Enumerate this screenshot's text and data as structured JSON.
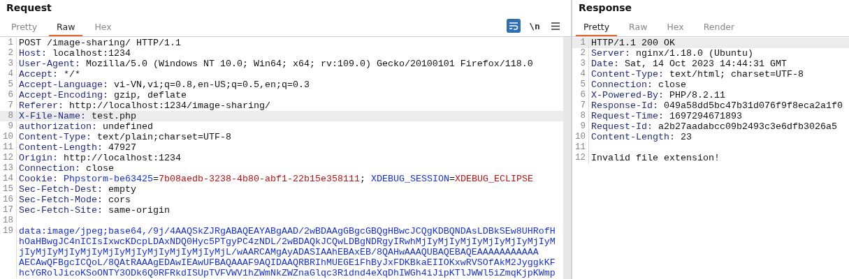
{
  "panes": [
    {
      "title": "Request",
      "tabs": [
        {
          "label": "Pretty",
          "selected": false
        },
        {
          "label": "Raw",
          "selected": true
        },
        {
          "label": "Hex",
          "selected": false
        }
      ],
      "tools": [
        {
          "kind": "wrap",
          "active": true
        },
        {
          "kind": "newline",
          "label": "\\n"
        },
        {
          "kind": "menu"
        }
      ],
      "lines": [
        {
          "number": "1",
          "highlighted": false,
          "segments": [
            {
              "kind": "text",
              "text": "POST /image-sharing/ HTTP/1.1"
            }
          ]
        },
        {
          "number": "2",
          "highlighted": false,
          "segments": [
            {
              "kind": "name",
              "text": "Host:"
            },
            {
              "kind": "text",
              "text": " localhost:1234"
            }
          ]
        },
        {
          "number": "3",
          "highlighted": false,
          "segments": [
            {
              "kind": "name",
              "text": "User-Agent:"
            },
            {
              "kind": "text",
              "text": " Mozilla/5.0 (Windows NT 10.0; Win64; x64; rv:109.0) Gecko/20100101 Firefox/118.0"
            }
          ]
        },
        {
          "number": "4",
          "highlighted": false,
          "segments": [
            {
              "kind": "name",
              "text": "Accept:"
            },
            {
              "kind": "text",
              "text": " */*"
            }
          ]
        },
        {
          "number": "5",
          "highlighted": false,
          "segments": [
            {
              "kind": "name",
              "text": "Accept-Language:"
            },
            {
              "kind": "text",
              "text": " vi-VN,vi;q=0.8,en-US;q=0.5,en;q=0.3"
            }
          ]
        },
        {
          "number": "6",
          "highlighted": false,
          "segments": [
            {
              "kind": "name",
              "text": "Accept-Encoding:"
            },
            {
              "kind": "text",
              "text": " gzip, deflate"
            }
          ]
        },
        {
          "number": "7",
          "highlighted": false,
          "segments": [
            {
              "kind": "name",
              "text": "Referer:"
            },
            {
              "kind": "text",
              "text": " http://localhost:1234/image-sharing/"
            }
          ]
        },
        {
          "number": "8",
          "highlighted": true,
          "segments": [
            {
              "kind": "name",
              "text": "X-File-Name:"
            },
            {
              "kind": "text",
              "text": " test.php"
            }
          ]
        },
        {
          "number": "9",
          "highlighted": false,
          "segments": [
            {
              "kind": "name",
              "text": "authorization:"
            },
            {
              "kind": "text",
              "text": " undefined"
            }
          ]
        },
        {
          "number": "10",
          "highlighted": false,
          "segments": [
            {
              "kind": "name",
              "text": "Content-Type:"
            },
            {
              "kind": "text",
              "text": " text/plain;charset=UTF-8"
            }
          ]
        },
        {
          "number": "11",
          "highlighted": false,
          "segments": [
            {
              "kind": "name",
              "text": "Content-Length:"
            },
            {
              "kind": "text",
              "text": " 47927"
            }
          ]
        },
        {
          "number": "12",
          "highlighted": false,
          "segments": [
            {
              "kind": "name",
              "text": "Origin:"
            },
            {
              "kind": "text",
              "text": " http://localhost:1234"
            }
          ]
        },
        {
          "number": "13",
          "highlighted": false,
          "segments": [
            {
              "kind": "name",
              "text": "Connection:"
            },
            {
              "kind": "text",
              "text": " close"
            }
          ]
        },
        {
          "number": "14",
          "highlighted": false,
          "segments": [
            {
              "kind": "name",
              "text": "Cookie: "
            },
            {
              "kind": "cookie-name",
              "text": "Phpstorm-be63425"
            },
            {
              "kind": "text",
              "text": "="
            },
            {
              "kind": "cookie-value",
              "text": "7b08aedb-3238-4b80-abf1-22b15e358111"
            },
            {
              "kind": "text",
              "text": "; "
            },
            {
              "kind": "cookie-name",
              "text": "XDEBUG_SESSION"
            },
            {
              "kind": "text",
              "text": "="
            },
            {
              "kind": "cookie-value",
              "text": "XDEBUG_ECLIPSE"
            }
          ]
        },
        {
          "number": "15",
          "highlighted": false,
          "segments": [
            {
              "kind": "name",
              "text": "Sec-Fetch-Dest:"
            },
            {
              "kind": "text",
              "text": " empty"
            }
          ]
        },
        {
          "number": "16",
          "highlighted": false,
          "segments": [
            {
              "kind": "name",
              "text": "Sec-Fetch-Mode:"
            },
            {
              "kind": "text",
              "text": " cors"
            }
          ]
        },
        {
          "number": "17",
          "highlighted": false,
          "segments": [
            {
              "kind": "name",
              "text": "Sec-Fetch-Site:"
            },
            {
              "kind": "text",
              "text": " same-origin"
            }
          ]
        },
        {
          "number": "18",
          "highlighted": false
        },
        {
          "number": "19",
          "highlighted": false,
          "segments": [
            {
              "kind": "body",
              "text": "data:image/jpeg;base64,/9j/4AAQSkZJRgABAQEAYABgAAD/2wBDAAgGBgcGBQgHBwcJCQgKDBQNDAsLDBkSEw8UHRofH"
            }
          ],
          "continuation": [
            "hOaHBwgJC4nICIsIxwcKDcpLDAxNDQ0Hyc5PTgyPC4zNDL/2wBDAQkJCQwLDBgNDRgyIRwhMjIyMjIyMjIyMjIyMjIyMjIyM",
            "jIyMjIyMjIyMjIyMjIyMjIyMjIyMjIyMjIyMjL/wAARCAMgAyADASIAAhEBAxEB/8QAHwAAAQUBAQEBAQEAAAAAAAAAAA",
            "AECAwQFBgcICQoL/8QAtRAAAgEDAwIEAwUFBAQAAAF9AQIDAAQRBRIhMUEGE1FhByJxFDKBkaEIIOKxwRVSOfAkM2JyggkKF",
            "hcYGRolJicoKSoONTY3ODk6Q0RFRkdISUpTVFVWV1hZWmNkZWZnaGlqc3R1dnd4eXqDhIWGh4iJipKTlJWWl5iZmqKjpKWmp"
          ]
        }
      ]
    },
    {
      "title": "Response",
      "tabs": [
        {
          "label": "Pretty",
          "selected": true
        },
        {
          "label": "Raw",
          "selected": false
        },
        {
          "label": "Hex",
          "selected": false
        },
        {
          "label": "Render",
          "selected": false
        }
      ],
      "lines": [
        {
          "number": "1",
          "highlighted": true,
          "segments": [
            {
              "kind": "text",
              "text": "HTTP/1.1 200 OK"
            }
          ]
        },
        {
          "number": "2",
          "highlighted": false,
          "segments": [
            {
              "kind": "name",
              "text": "Server:"
            },
            {
              "kind": "text",
              "text": " nginx/1.18.0 (Ubuntu)"
            }
          ]
        },
        {
          "number": "3",
          "highlighted": false,
          "segments": [
            {
              "kind": "name",
              "text": "Date:"
            },
            {
              "kind": "text",
              "text": " Sat, 14 Oct 2023 14:44:31 GMT"
            }
          ]
        },
        {
          "number": "4",
          "highlighted": false,
          "segments": [
            {
              "kind": "name",
              "text": "Content-Type:"
            },
            {
              "kind": "text",
              "text": " text/html; charset=UTF-8"
            }
          ]
        },
        {
          "number": "5",
          "highlighted": false,
          "segments": [
            {
              "kind": "name",
              "text": "Connection:"
            },
            {
              "kind": "text",
              "text": " close"
            }
          ]
        },
        {
          "number": "6",
          "highlighted": false,
          "segments": [
            {
              "kind": "name",
              "text": "X-Powered-By:"
            },
            {
              "kind": "text",
              "text": " PHP/8.2.11"
            }
          ]
        },
        {
          "number": "7",
          "highlighted": false,
          "segments": [
            {
              "kind": "name",
              "text": "Response-Id:"
            },
            {
              "kind": "text",
              "text": " 049a58dd5bc47b31d076f9f8eca2a1f0"
            }
          ]
        },
        {
          "number": "8",
          "highlighted": false,
          "segments": [
            {
              "kind": "name",
              "text": "Request-Time:"
            },
            {
              "kind": "text",
              "text": " 1697294671893"
            }
          ]
        },
        {
          "number": "9",
          "highlighted": false,
          "segments": [
            {
              "kind": "name",
              "text": "Request-Id:"
            },
            {
              "kind": "text",
              "text": " a2b27aadabcc09b2493c3e6dfb3026a5"
            }
          ]
        },
        {
          "number": "10",
          "highlighted": false,
          "segments": [
            {
              "kind": "name",
              "text": "Content-Length:"
            },
            {
              "kind": "text",
              "text": " 23"
            }
          ]
        },
        {
          "number": "11",
          "highlighted": false
        },
        {
          "number": "12",
          "highlighted": false,
          "segments": [
            {
              "kind": "text",
              "text": "Invalid file extension!"
            }
          ]
        }
      ]
    }
  ]
}
